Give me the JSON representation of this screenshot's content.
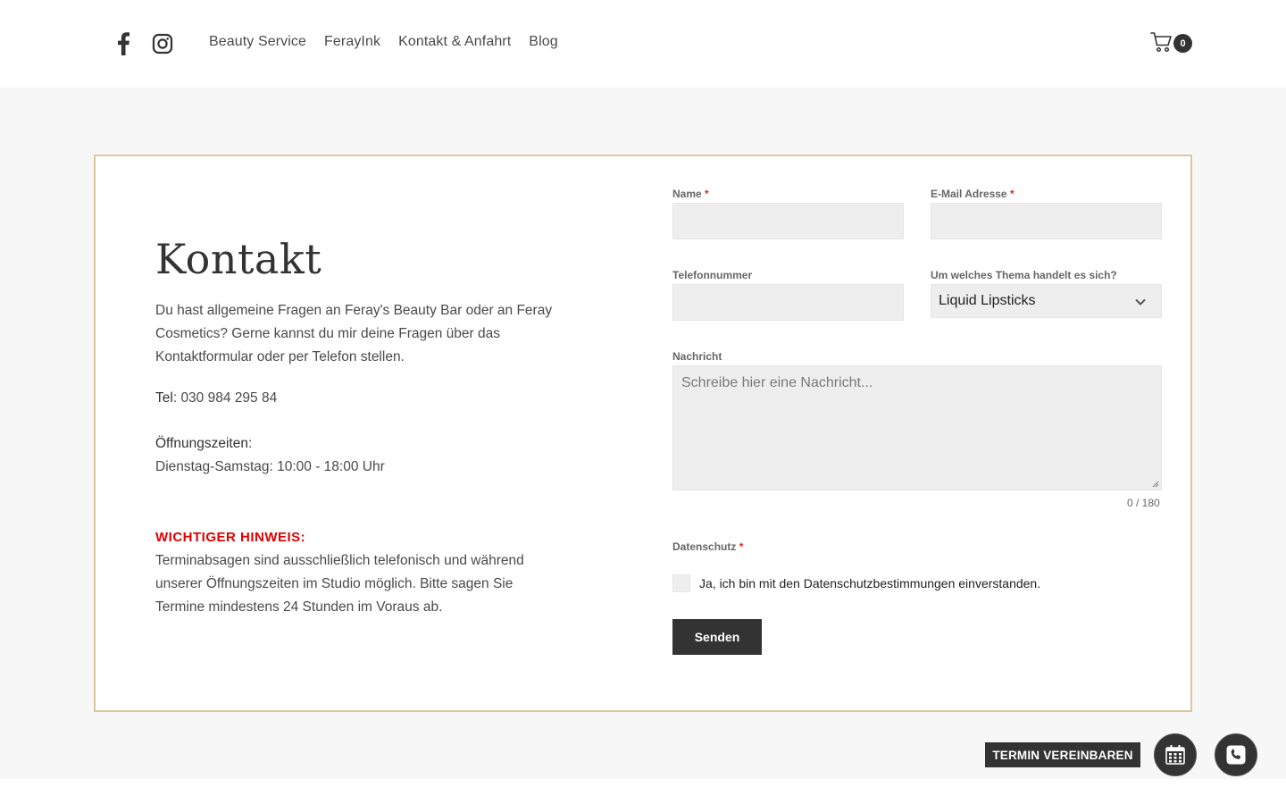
{
  "header": {
    "social": [
      {
        "name": "facebook",
        "icon": "facebook-icon"
      },
      {
        "name": "instagram",
        "icon": "instagram-icon"
      }
    ],
    "nav": [
      "Beauty Service",
      "FerayInk",
      "Kontakt & Anfahrt",
      "Blog"
    ],
    "cart_count": "0"
  },
  "contact": {
    "title": "Kontakt",
    "intro": "Du hast allgemeine Fragen an Feray's Beauty Bar oder an Feray Cosmetics? Gerne kannst du mir deine Fragen über das Kontaktformular oder per Telefon stellen.",
    "tel_label": "Tel",
    "tel_value": ": 030 984 295 84",
    "hours_label": "Öffnungszeiten",
    "hours_colon": ":",
    "hours_value": "Dienstag-Samstag: 10:00 - 18:00 Uhr",
    "warning_title": "WICHTIGER HINWEIS:",
    "warning_text": "Terminabsagen sind ausschließlich telefonisch und während unserer Öffnungszeiten im Studio möglich. Bitte sagen Sie Termine mindestens 24 Stunden im Voraus ab."
  },
  "form": {
    "name_label": "Name",
    "email_label": "E-Mail Adresse",
    "phone_label": "Telefonnummer",
    "topic_label": "Um welches Thema handelt es sich?",
    "topic_value": "Liquid Lipsticks",
    "message_label": "Nachricht",
    "message_placeholder": "Schreibe hier eine Nachricht...",
    "counter": "0 / 180",
    "privacy_label": "Datenschutz",
    "privacy_check": "Ja, ich bin mit den Datenschutzbestimmungen einverstanden.",
    "required_mark": "*",
    "submit": "Senden"
  },
  "floating": {
    "termin": "TERMIN VEREINBAREN"
  },
  "colors": {
    "accent_border": "#d8c7a0",
    "dark": "#333333",
    "warning": "#e00000",
    "field_bg": "#eeeeee",
    "page_bg": "#f7f7f7"
  }
}
